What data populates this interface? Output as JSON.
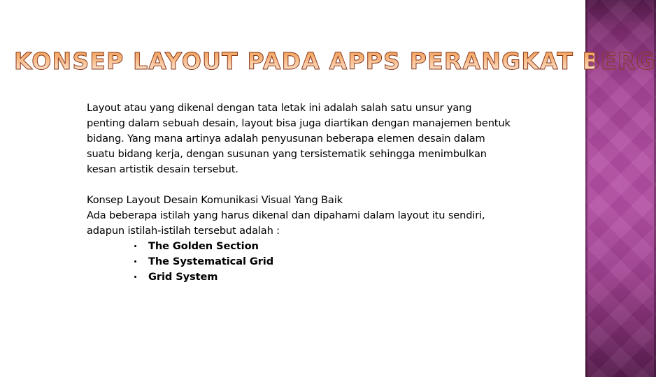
{
  "slide": {
    "title": "KONSEP LAYOUT PADA APPS PERANGKAT BERGERAK",
    "background_color": "#ffffff"
  },
  "side_band": {
    "name": "decorative-purple-band",
    "base_color": "#b0479f",
    "top_color": "#4d0f3e",
    "mid_color": "#b44aad",
    "bottom_color": "#5d1450",
    "pattern": "diamond-lattice"
  },
  "title_style": {
    "gradient_top": "#ef9a4a",
    "gradient_bottom": "#ffffff",
    "outline_color": "#8a3b20"
  },
  "body": {
    "paragraph_1": [
      "Layout atau yang dikenal dengan tata letak ini adalah salah satu unsur yang",
      "penting dalam sebuah desain, layout bisa juga diartikan dengan manajemen bentuk",
      "bidang. Yang mana artinya adalah penyusunan beberapa elemen desain dalam",
      "suatu bidang kerja, dengan susunan yang tersistematik sehingga menimbulkan",
      "kesan artistik desain tersebut."
    ],
    "paragraph_2": [
      "Konsep Layout Desain Komunikasi Visual Yang Baik",
      "Ada beberapa istilah yang harus dikenal dan dipahami dalam layout itu sendiri,",
      "adapun istilah-istilah tersebut adalah :"
    ],
    "bullets": [
      "The Golden Section",
      "The Systematical Grid",
      "Grid System"
    ]
  }
}
